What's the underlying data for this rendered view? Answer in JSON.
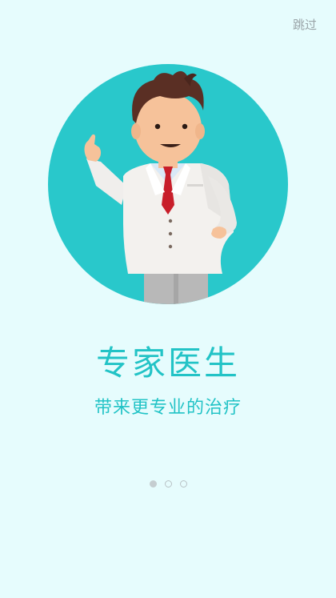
{
  "skip_label": "跳过",
  "title": "专家医生",
  "subtitle": "带来更专业的治疗",
  "pager": {
    "total": 3,
    "current": 1
  },
  "colors": {
    "background": "#e6fcfd",
    "accent": "#22c3c6",
    "circle": "#29c8cb"
  },
  "illustration": "doctor-illustration"
}
